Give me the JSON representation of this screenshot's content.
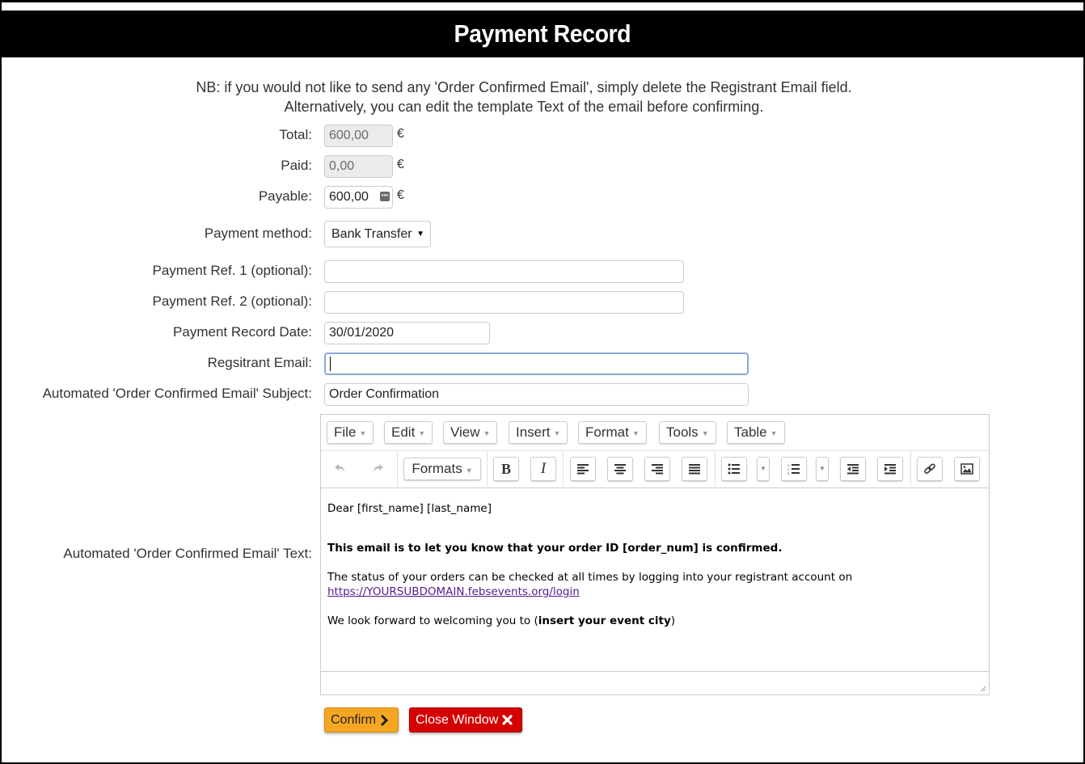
{
  "window": {
    "title": "Payment Record"
  },
  "notice": {
    "line1": "NB: if you would not like to send any 'Order Confirmed Email', simply delete the Registrant Email field.",
    "line2": "Alternatively, you can edit the template Text of the email before confirming."
  },
  "form": {
    "total": {
      "label": "Total:",
      "value": "600,00",
      "currency": "€"
    },
    "paid": {
      "label": "Paid:",
      "value": "0,00",
      "currency": "€"
    },
    "payable": {
      "label": "Payable:",
      "value": "600,00",
      "currency": "€"
    },
    "payment_method": {
      "label": "Payment method:",
      "value": "Bank Transfer"
    },
    "ref1": {
      "label": "Payment Ref. 1 (optional):",
      "value": ""
    },
    "ref2": {
      "label": "Payment Ref. 2 (optional):",
      "value": ""
    },
    "record_date": {
      "label": "Payment Record Date:",
      "value": "30/01/2020"
    },
    "registrant_email": {
      "label": "Regsitrant Email:",
      "value": ""
    },
    "email_subject": {
      "label": "Automated 'Order Confirmed Email' Subject:",
      "value": "Order Confirmation"
    },
    "email_text": {
      "label": "Automated 'Order Confirmed Email' Text:"
    }
  },
  "editor": {
    "menu": [
      "File",
      "Edit",
      "View",
      "Insert",
      "Format",
      "Tools",
      "Table"
    ],
    "formats_label": "Formats",
    "toolbar_icons": [
      "undo-icon",
      "redo-icon",
      "bold-icon",
      "italic-icon",
      "align-left-icon",
      "align-center-icon",
      "align-right-icon",
      "align-justify-icon",
      "bullet-list-icon",
      "numbered-list-icon",
      "outdent-icon",
      "indent-icon",
      "link-icon",
      "image-icon"
    ],
    "body": {
      "greeting": "Dear [first_name] [last_name]",
      "headline": "This email is to let you know that your order ID [order_num] is confirmed.",
      "status_line": "The status of your orders can be checked at all times by logging into your registrant account on",
      "login_link": "https://YOURSUBDOMAIN.febsevents.org/login",
      "closing_prefix": "We look forward to welcoming you to (",
      "closing_bold": "insert your event city",
      "closing_suffix": ")"
    }
  },
  "actions": {
    "confirm": "Confirm",
    "close": "Close Window"
  },
  "colors": {
    "title_bg": "#000000",
    "confirm_bg": "#f5a623",
    "close_bg": "#d40000",
    "focus_border": "#8aa9d6",
    "link": "#551a8b"
  }
}
